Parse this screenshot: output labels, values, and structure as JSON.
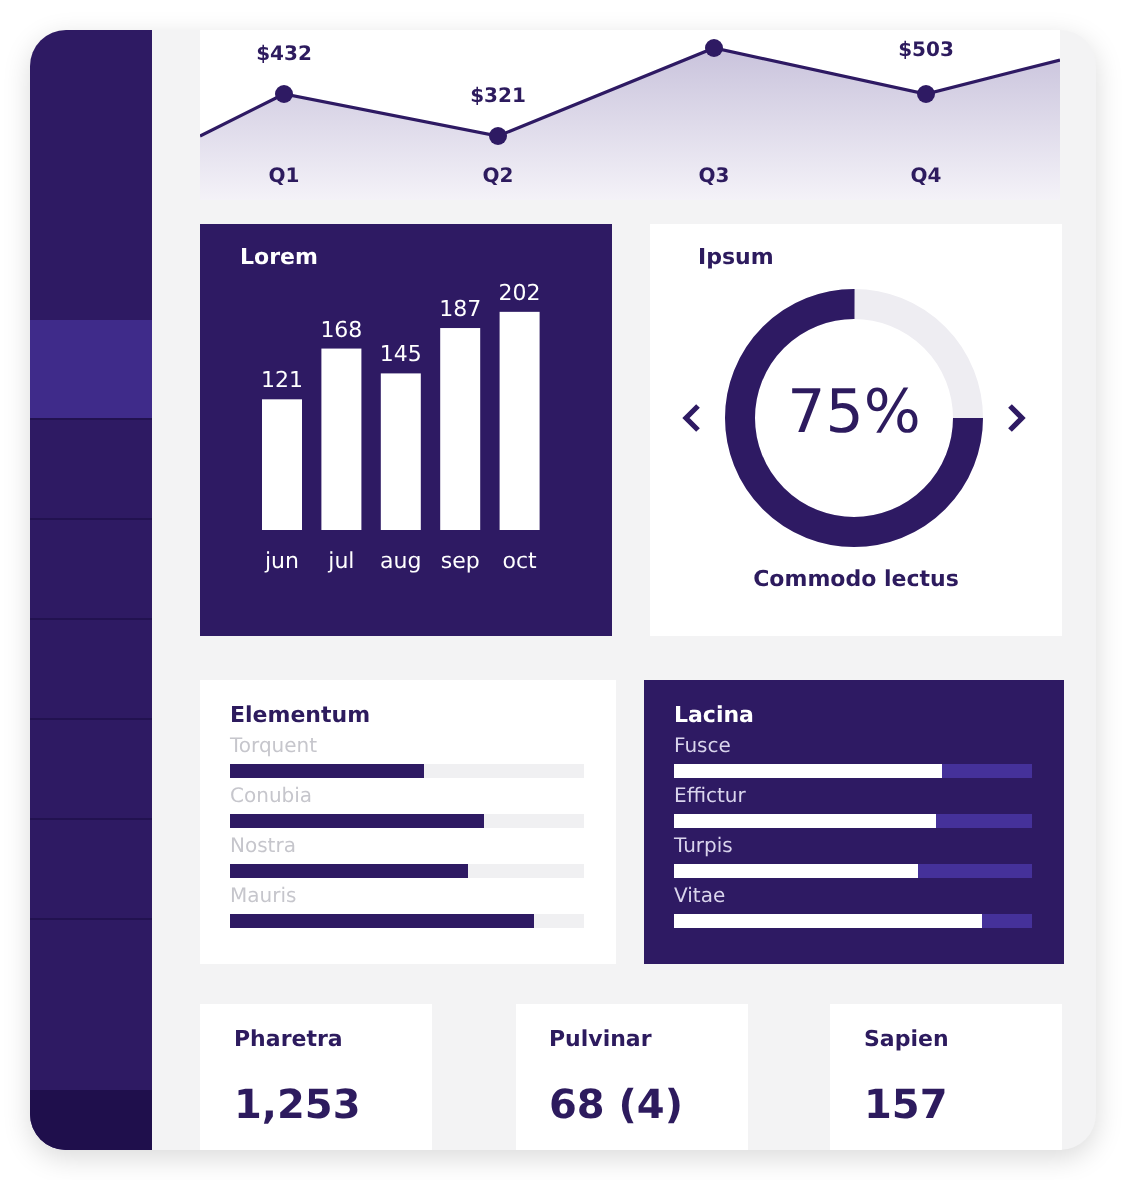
{
  "sidebar": {
    "items": [
      {
        "selected": true
      },
      {
        "selected": false
      },
      {
        "selected": false
      },
      {
        "selected": false
      },
      {
        "selected": false
      },
      {
        "selected": false
      }
    ]
  },
  "revenue": {
    "points": [
      {
        "label": "Q1",
        "value": "$432"
      },
      {
        "label": "Q2",
        "value": "$321"
      },
      {
        "label": "Q3"
      },
      {
        "label": "Q4",
        "value": "$503"
      }
    ]
  },
  "lorem": {
    "title": "Lorem",
    "chart_data": {
      "type": "bar",
      "categories": [
        "jun",
        "jul",
        "aug",
        "sep",
        "oct"
      ],
      "values": [
        121,
        168,
        145,
        187,
        202
      ],
      "data_labels": true
    }
  },
  "ipsum": {
    "title": "Ipsum",
    "level": 0.75,
    "percent": "75%",
    "caption": "Commodo lectus"
  },
  "elementum": {
    "title": "Elementum",
    "bars": [
      {
        "label": "Torquent",
        "level": 0.55
      },
      {
        "label": "Conubia",
        "level": 0.72
      },
      {
        "label": "Nostra",
        "level": 0.67
      },
      {
        "label": "Mauris",
        "level": 0.86
      }
    ]
  },
  "lacina": {
    "title": "Lacina",
    "bars": [
      {
        "label": "Fusce",
        "level": 0.75
      },
      {
        "label": "Effictur",
        "level": 0.73
      },
      {
        "label": "Turpis",
        "level": 0.68
      },
      {
        "label": "Vitae",
        "level": 0.86
      }
    ]
  },
  "stats": [
    {
      "label": "Pharetra",
      "value": "1,253"
    },
    {
      "label": "Pulvinar",
      "value": "68 (4)"
    },
    {
      "label": "Sapien",
      "value": "157"
    }
  ]
}
